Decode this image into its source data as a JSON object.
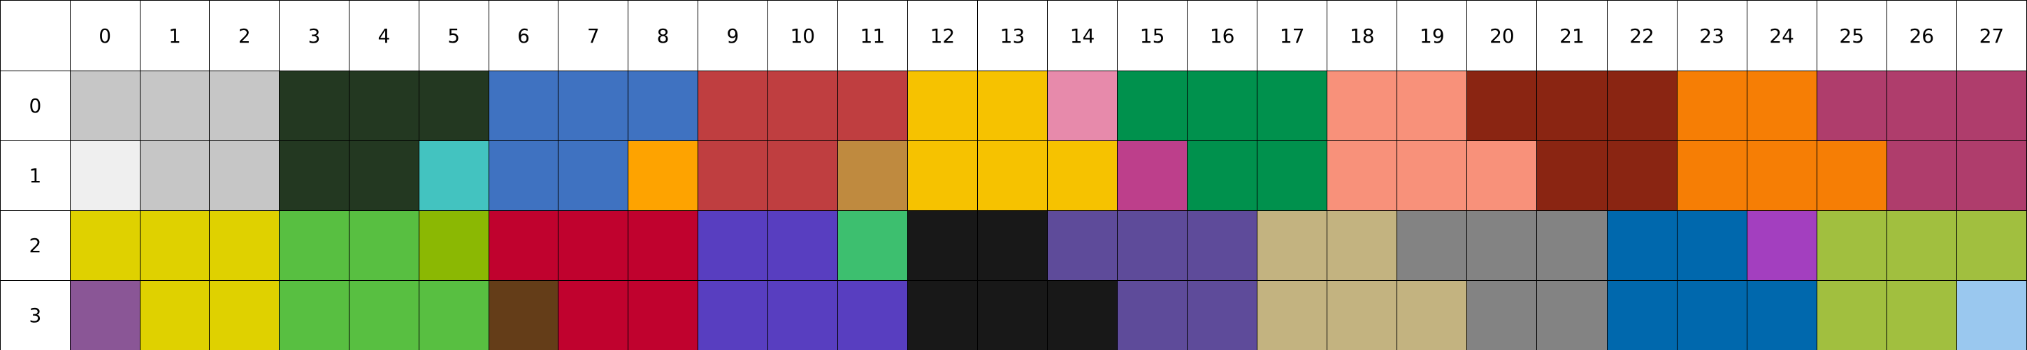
{
  "corner_label": "",
  "col_labels": [
    "0",
    "1",
    "2",
    "3",
    "4",
    "5",
    "6",
    "7",
    "8",
    "9",
    "10",
    "11",
    "12",
    "13",
    "14",
    "15",
    "16",
    "17",
    "18",
    "19",
    "20",
    "21",
    "22",
    "23",
    "24",
    "25",
    "26",
    "27"
  ],
  "row_labels": [
    "0",
    "1",
    "2",
    "3"
  ],
  "grid_colors": [
    [
      "#c6c6c6",
      "#c6c6c6",
      "#c6c6c6",
      "#233821",
      "#233821",
      "#233821",
      "#3f72c1",
      "#3f72c1",
      "#3f72c1",
      "#bf3e40",
      "#bf3e40",
      "#bf3e40",
      "#f6c200",
      "#f6c200",
      "#e78aab",
      "#00914d",
      "#00914d",
      "#00914d",
      "#f8917a",
      "#f8917a",
      "#8a2512",
      "#8a2512",
      "#8a2512",
      "#f67e05",
      "#f67e05",
      "#af3d6c",
      "#af3d6c",
      "#af3d6c"
    ],
    [
      "#efefef",
      "#c6c6c6",
      "#c6c6c6",
      "#233821",
      "#233821",
      "#43c3c0",
      "#3f72c1",
      "#3f72c1",
      "#fea300",
      "#bf3e40",
      "#bf3e40",
      "#bf8a3f",
      "#f6c200",
      "#f6c200",
      "#f6c200",
      "#bd3f8b",
      "#00914d",
      "#00914d",
      "#f8917a",
      "#f8917a",
      "#f8917a",
      "#8a2512",
      "#8a2512",
      "#f67e05",
      "#f67e05",
      "#f67e05",
      "#af3d6c",
      "#af3d6c"
    ],
    [
      "#dfd100",
      "#dfd100",
      "#dfd100",
      "#58bf41",
      "#58bf41",
      "#8bb803",
      "#c0022e",
      "#c0022e",
      "#c0022e",
      "#583ec0",
      "#583ec0",
      "#3dbf6f",
      "#181818",
      "#181818",
      "#5e4b9a",
      "#5e4b9a",
      "#5e4b9a",
      "#c3b380",
      "#c3b380",
      "#838383",
      "#838383",
      "#838383",
      "#0068ad",
      "#0068ad",
      "#a33fbf",
      "#a1bf3f",
      "#a1bf3f",
      "#a1bf3f"
    ],
    [
      "#8a5696",
      "#dfd100",
      "#dfd100",
      "#58bf41",
      "#58bf41",
      "#58bf41",
      "#643d18",
      "#c0022e",
      "#c0022e",
      "#583ec0",
      "#583ec0",
      "#583ec0",
      "#181818",
      "#181818",
      "#181818",
      "#5e4b9a",
      "#5e4b9a",
      "#c3b380",
      "#c3b380",
      "#c3b380",
      "#838383",
      "#838383",
      "#0068ad",
      "#0068ad",
      "#0068ad",
      "#a1bf3f",
      "#a1bf3f",
      "#9ac8ef"
    ]
  ]
}
